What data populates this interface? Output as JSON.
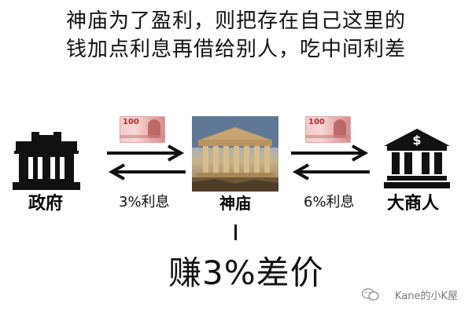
{
  "title": {
    "line1": "神庙为了盈利，则把存在自己这里的",
    "line2": "钱加点利息再借给别人，吃中间利差"
  },
  "nodes": {
    "left_label": "政府",
    "center_label": "神庙",
    "right_label": "大商人"
  },
  "money": {
    "denomination": "100"
  },
  "rates": {
    "left": "3%利息",
    "right": "6%利息"
  },
  "result": "赚3%差价",
  "watermark": "Kane的小K屋",
  "colors": {
    "text": "#111111",
    "bill_red": "#e0a0a0",
    "watermark": "#777777"
  }
}
